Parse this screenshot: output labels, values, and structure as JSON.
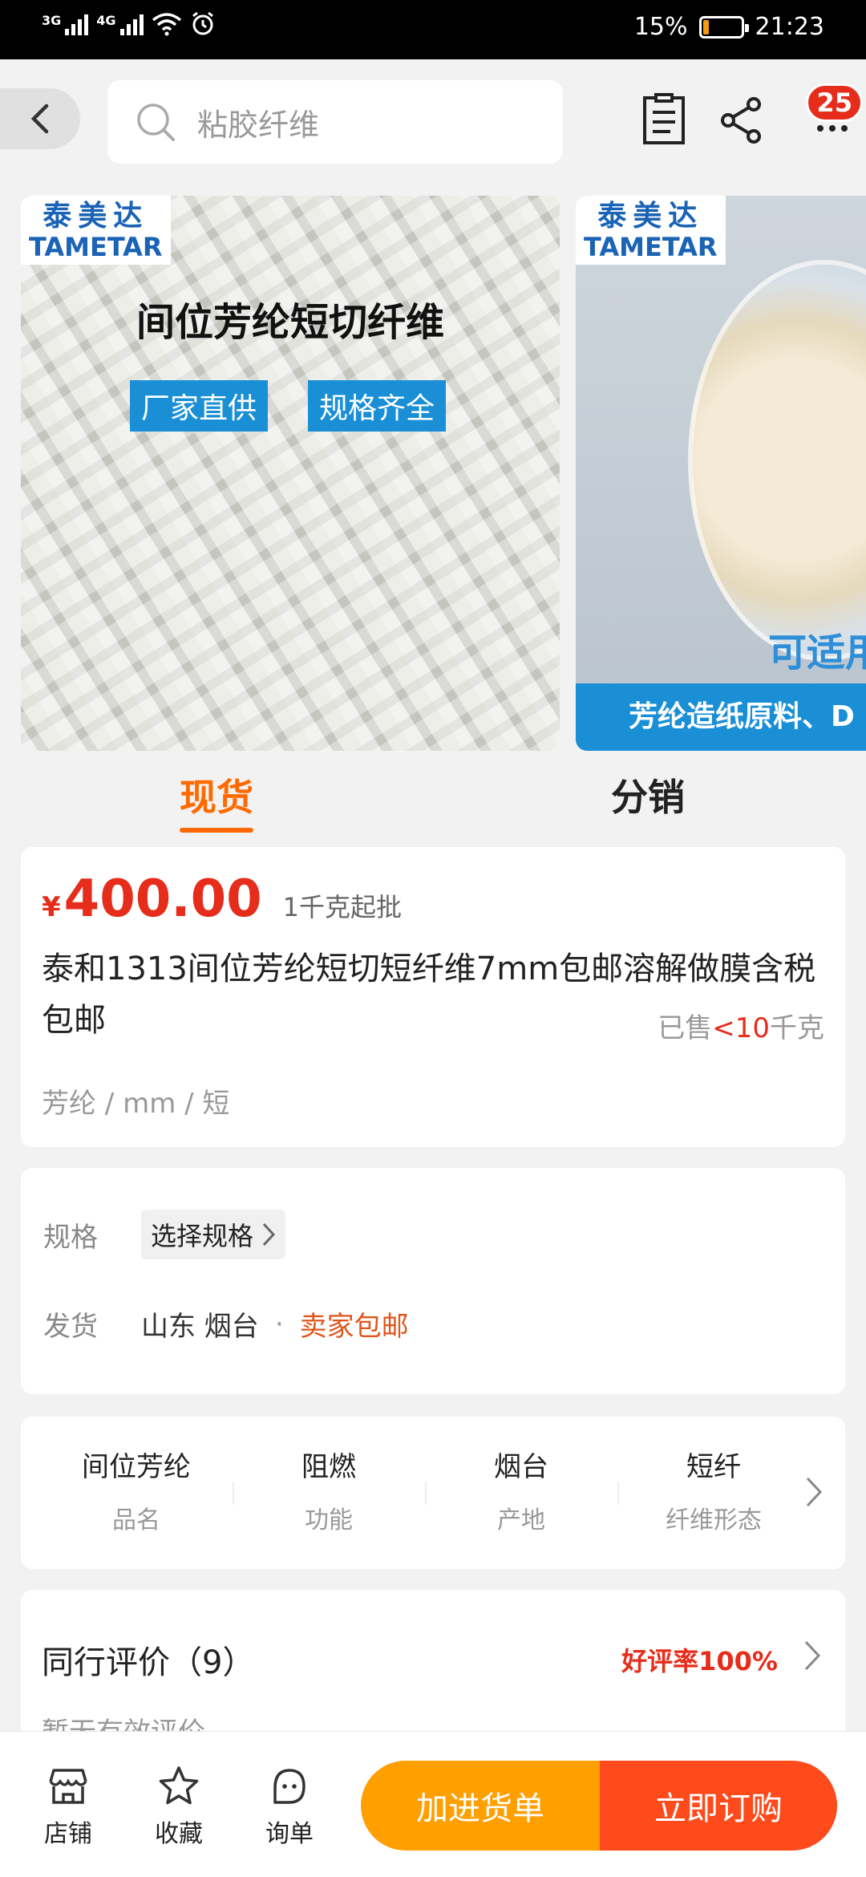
{
  "status_bar": {
    "net1": "3G",
    "net2": "4G",
    "battery": "15%",
    "battery_level": 0.15,
    "time": "21:23"
  },
  "topbar": {
    "search_placeholder": "粘胶纤维",
    "badge_count": "25",
    "icons": [
      "back-icon",
      "search-icon",
      "list-icon",
      "share-icon",
      "more-icon"
    ]
  },
  "carousel": {
    "slide1": {
      "brand_cn": "泰美达",
      "brand_en": "TAMETAR",
      "title": "间位芳纶短切纤维",
      "tags": [
        "厂家直供",
        "规格齐全"
      ]
    },
    "slide2": {
      "brand_cn": "泰美达",
      "brand_en": "TAMETAR",
      "label": "可适用",
      "band": "芳纶造纸原料、D"
    }
  },
  "tabs": [
    "现货",
    "分销"
  ],
  "product": {
    "currency": "¥",
    "price": "400.00",
    "moq": "1千克起批",
    "title": "泰和1313间位芳纶短切短纤维7mm包邮溶解做膜含税包邮",
    "sold_prefix": "已售",
    "sold_value": "<10",
    "sold_unit": "千克",
    "attrs": "芳纶 / mm / 短"
  },
  "spec": {
    "spec_label": "规格",
    "spec_choice": "选择规格",
    "ship_label": "发货",
    "ship_location": "山东 烟台",
    "ship_sep": "·",
    "ship_free": "卖家包邮"
  },
  "properties": [
    {
      "value": "间位芳纶",
      "key": "品名"
    },
    {
      "value": "阻燃",
      "key": "功能"
    },
    {
      "value": "烟台",
      "key": "产地"
    },
    {
      "value": "短纤",
      "key": "纤维形态"
    }
  ],
  "review": {
    "title": "同行评价（9）",
    "rate": "好评率100%",
    "empty": "暂无有效评价"
  },
  "bottom_bar": {
    "store": "店铺",
    "favorite": "收藏",
    "inquiry": "询单",
    "add_cart": "加进货单",
    "buy_now": "立即订购"
  },
  "colors": {
    "accent": "#ff6a00",
    "price": "#e62d1b",
    "cart_button": "#ff9f00",
    "buy_button": "#ff4a1b",
    "brand_blue": "#1a63b5"
  }
}
